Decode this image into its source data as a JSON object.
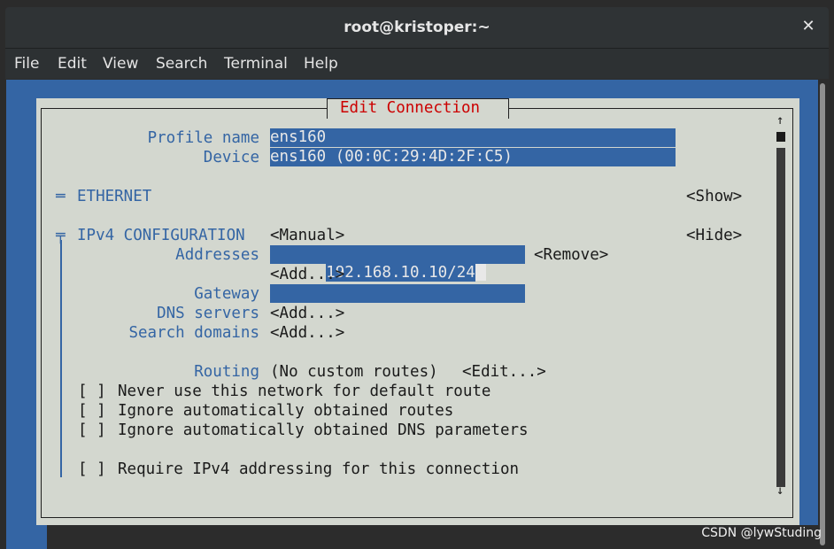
{
  "window": {
    "title": "root@kristoper:~",
    "close_glyph": "✕"
  },
  "menu": [
    "File",
    "Edit",
    "View",
    "Search",
    "Terminal",
    "Help"
  ],
  "dialog": {
    "title": "Edit Connection",
    "profile_name_label": "Profile name",
    "profile_name_value": "ens160",
    "device_label": "Device",
    "device_value": "ens160 (00:0C:29:4D:2F:C5)",
    "ethernet_marker": "═",
    "ethernet_label": "ETHERNET",
    "ethernet_toggle": "<Show>",
    "ipv4_marker": "╤",
    "ipv4_label": "IPv4 CONFIGURATION",
    "ipv4_mode": "<Manual>",
    "ipv4_toggle": "<Hide>",
    "addresses_label": "Addresses",
    "address_value": "192.168.10.10/24",
    "remove_button": "<Remove>",
    "add_address_button": "<Add...>",
    "gateway_label": "Gateway",
    "gateway_value": "",
    "dns_label": "DNS servers",
    "dns_add_button": "<Add...>",
    "search_domains_label": "Search domains",
    "search_add_button": "<Add...>",
    "routing_label": "Routing",
    "routing_value": "(No custom routes)",
    "routing_edit_button": "<Edit...>",
    "checkbox_mark": "[ ]",
    "checkboxes": [
      "Never use this network for default route",
      "Ignore automatically obtained routes",
      "Ignore automatically obtained DNS parameters",
      "Require IPv4 addressing for this connection"
    ],
    "scroll_up_arrow": "↑",
    "scroll_down_arrow": "↓"
  },
  "watermark": "CSDN @lywStuding",
  "colors": {
    "terminal_blue": "#3465a4",
    "dialog_gray": "#d3d7cf",
    "title_red": "#cc0000"
  }
}
